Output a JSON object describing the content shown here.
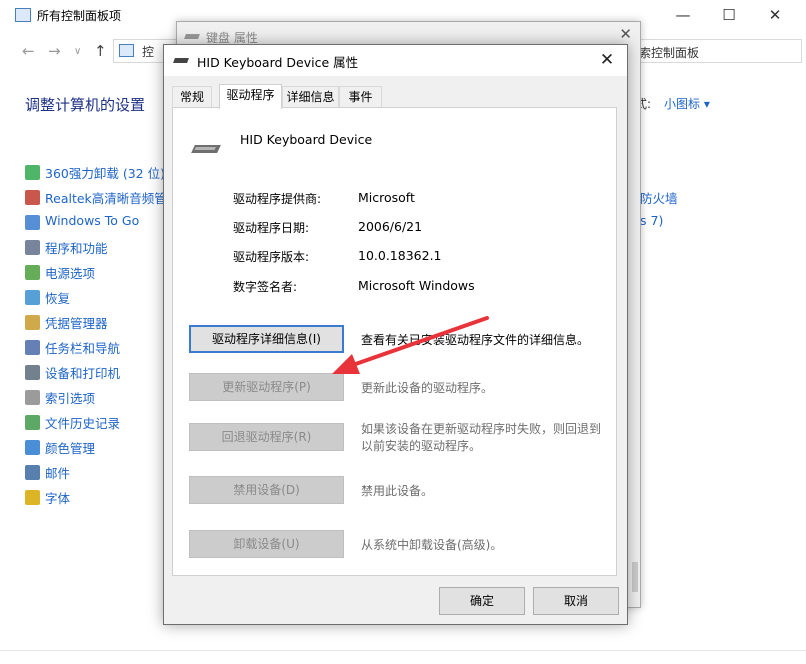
{
  "control_panel": {
    "window_title": "所有控制面板项",
    "address_text": "控",
    "search_text": "索控制面板",
    "heading": "调整计算机的设置",
    "view_label": "式:",
    "view_value": "小图标 ▾",
    "items": [
      {
        "label": "360强力卸载 (32 位)",
        "color": "#2fa84f"
      },
      {
        "label": "Realtek高清晰音频管",
        "color": "#c0392b"
      },
      {
        "label": "Windows To Go",
        "color": "#3a7bd0"
      },
      {
        "label": "程序和功能",
        "color": "#5f6f8a"
      },
      {
        "label": "电源选项",
        "color": "#4a9f3c"
      },
      {
        "label": "恢复",
        "color": "#3a8fd0"
      },
      {
        "label": "凭据管理器",
        "color": "#c79a2a"
      },
      {
        "label": "任务栏和导航",
        "color": "#4a6aa8"
      },
      {
        "label": "设备和打印机",
        "color": "#5a6a7a"
      },
      {
        "label": "索引选项",
        "color": "#8a8a8a"
      },
      {
        "label": "文件历史记录",
        "color": "#3f9a4a"
      },
      {
        "label": "颜色管理",
        "color": "#2a7ad0"
      },
      {
        "label": "邮件",
        "color": "#3a6aa0"
      },
      {
        "label": "字体",
        "color": "#d6a800"
      }
    ],
    "right_items": [
      "防火墙",
      "s 7)"
    ]
  },
  "keyboard_window": {
    "title": "键盘 属性"
  },
  "dialog": {
    "title": "HID Keyboard Device 属性",
    "tabs": [
      "常规",
      "驱动程序",
      "详细信息",
      "事件"
    ],
    "active_tab": "驱动程序",
    "device_name": "HID Keyboard Device",
    "properties": [
      {
        "label": "驱动程序提供商:",
        "value": "Microsoft"
      },
      {
        "label": "驱动程序日期:",
        "value": "2006/6/21"
      },
      {
        "label": "驱动程序版本:",
        "value": "10.0.18362.1"
      },
      {
        "label": "数字签名者:",
        "value": "Microsoft Windows"
      }
    ],
    "actions": [
      {
        "button": "驱动程序详细信息(I)",
        "desc": "查看有关已安装驱动程序文件的详细信息。",
        "enabled": true
      },
      {
        "button": "更新驱动程序(P)",
        "desc": "更新此设备的驱动程序。",
        "enabled": false
      },
      {
        "button": "回退驱动程序(R)",
        "desc": "如果该设备在更新驱动程序时失败，则回退到以前安装的驱动程序。",
        "enabled": false
      },
      {
        "button": "禁用设备(D)",
        "desc": "禁用此设备。",
        "enabled": false
      },
      {
        "button": "卸载设备(U)",
        "desc": "从系统中卸载设备(高级)。",
        "enabled": false
      }
    ],
    "ok_label": "确定",
    "cancel_label": "取消"
  },
  "annotation_color": "#e8333a"
}
